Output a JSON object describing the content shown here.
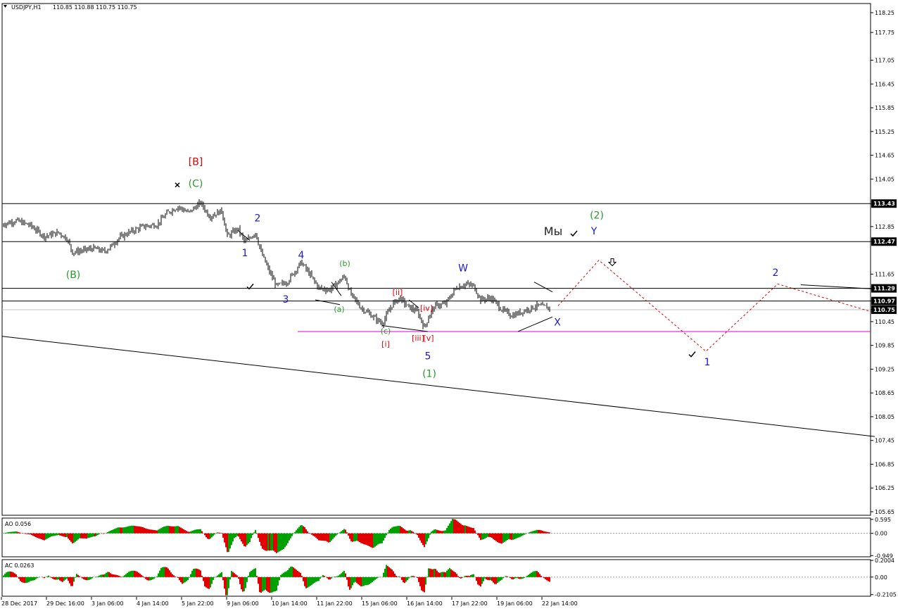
{
  "chart_data": {
    "type": "candlestick",
    "header": {
      "symbol": "USDJPY,H1",
      "quote": "110.85 110.88 110.75 110.75"
    },
    "price_axis": {
      "range": [
        105.65,
        118.25
      ],
      "ticks": [
        "118.25",
        "117.75",
        "117.05",
        "116.45",
        "115.85",
        "115.25",
        "114.65",
        "114.05",
        "113.43",
        "112.85",
        "112.47",
        "111.65",
        "111.29",
        "110.97",
        "110.75",
        "110.45",
        "109.85",
        "109.25",
        "108.65",
        "108.05",
        "107.45",
        "106.85",
        "106.25",
        "105.65"
      ]
    },
    "time_axis": {
      "labels": [
        "28 Dec 2017",
        "29 Dec 16:00",
        "3 Jan 06:00",
        "4 Jan 14:00",
        "5 Jan 22:00",
        "9 Jan 06:00",
        "10 Jan 14:00",
        "11 Jan 22:00",
        "15 Jan 06:00",
        "16 Jan 14:00",
        "17 Jan 22:00",
        "19 Jan 06:00",
        "22 Jan 14:00"
      ]
    },
    "price_tags": [
      {
        "value": "113.43",
        "price": 113.43
      },
      {
        "value": "112.47",
        "price": 112.47
      },
      {
        "value": "111.29",
        "price": 111.29
      },
      {
        "value": "110.97",
        "price": 110.97
      },
      {
        "value": "110.75",
        "price": 110.75
      }
    ],
    "horizontal_levels": [
      113.43,
      112.47,
      111.29,
      110.97
    ],
    "support_level": 110.2,
    "trendline": {
      "from": [
        0,
        110.08
      ],
      "to": [
        1240,
        107.55
      ]
    },
    "price_path": [
      [
        0,
        112.9
      ],
      [
        20,
        113.0
      ],
      [
        40,
        112.88
      ],
      [
        60,
        112.6
      ],
      [
        80,
        112.7
      ],
      [
        92,
        112.55
      ],
      [
        100,
        112.2
      ],
      [
        115,
        112.25
      ],
      [
        130,
        112.3
      ],
      [
        145,
        112.22
      ],
      [
        155,
        112.35
      ],
      [
        165,
        112.55
      ],
      [
        180,
        112.7
      ],
      [
        200,
        112.85
      ],
      [
        220,
        112.9
      ],
      [
        235,
        113.2
      ],
      [
        250,
        113.35
      ],
      [
        265,
        113.2
      ],
      [
        282,
        113.45
      ],
      [
        295,
        113.1
      ],
      [
        312,
        113.25
      ],
      [
        320,
        112.6
      ],
      [
        335,
        112.8
      ],
      [
        345,
        112.45
      ],
      [
        360,
        112.7
      ],
      [
        368,
        112.2
      ],
      [
        380,
        111.7
      ],
      [
        390,
        111.35
      ],
      [
        405,
        111.45
      ],
      [
        415,
        111.7
      ],
      [
        425,
        111.95
      ],
      [
        435,
        111.7
      ],
      [
        450,
        111.3
      ],
      [
        465,
        111.25
      ],
      [
        478,
        111.45
      ],
      [
        487,
        111.6
      ],
      [
        495,
        111.15
      ],
      [
        510,
        110.8
      ],
      [
        525,
        110.6
      ],
      [
        540,
        110.4
      ],
      [
        555,
        110.9
      ],
      [
        565,
        111.05
      ],
      [
        575,
        110.85
      ],
      [
        590,
        110.7
      ],
      [
        600,
        110.3
      ],
      [
        607,
        110.6
      ],
      [
        615,
        110.85
      ],
      [
        630,
        110.9
      ],
      [
        645,
        111.3
      ],
      [
        658,
        111.4
      ],
      [
        670,
        111.35
      ],
      [
        680,
        111.0
      ],
      [
        695,
        111.05
      ],
      [
        710,
        110.75
      ],
      [
        725,
        110.6
      ],
      [
        745,
        110.75
      ],
      [
        760,
        110.85
      ],
      [
        778,
        110.8
      ]
    ],
    "forecast_path": [
      [
        790,
        110.85
      ],
      [
        848,
        112.0
      ],
      [
        1000,
        109.7
      ],
      [
        1102,
        111.4
      ],
      [
        1235,
        110.7
      ]
    ],
    "forecast_resistance": [
      [
        1135,
        111.38
      ],
      [
        1235,
        111.28
      ]
    ],
    "wedge_lines": [
      {
        "from": [
          733,
          110.2
        ],
        "to": [
          782,
          110.57
        ]
      },
      {
        "from": [
          756,
          111.45
        ],
        "to": [
          782,
          111.2
        ]
      },
      {
        "from": [
          335,
          112.75
        ],
        "to": [
          352,
          112.5
        ]
      },
      {
        "from": [
          468,
          111.45
        ],
        "to": [
          482,
          111.1
        ]
      },
      {
        "from": [
          445,
          111.0
        ],
        "to": [
          480,
          110.88
        ]
      },
      {
        "from": [
          540,
          110.35
        ],
        "to": [
          605,
          110.2
        ]
      },
      {
        "from": [
          578,
          111.0
        ],
        "to": [
          592,
          110.8
        ]
      }
    ],
    "wave_labels": [
      {
        "text": "[B]",
        "t": 275,
        "p": 114.4,
        "color": "#e00000",
        "size": 14
      },
      {
        "text": "(C)",
        "t": 275,
        "p": 113.85,
        "color": "#2a9a2a",
        "size": 14
      },
      {
        "text": "(B)",
        "t": 101,
        "p": 111.55,
        "color": "#2a9a2a",
        "size": 14
      },
      {
        "text": "2",
        "t": 363,
        "p": 112.98,
        "color": "#1a1acc",
        "size": 14
      },
      {
        "text": "1",
        "t": 345,
        "p": 112.1,
        "color": "#1a1acc",
        "size": 14
      },
      {
        "text": "4",
        "t": 425,
        "p": 112.05,
        "color": "#1a1acc",
        "size": 14
      },
      {
        "text": "3",
        "t": 403,
        "p": 110.93,
        "color": "#1a1acc",
        "size": 14
      },
      {
        "text": "(b)",
        "t": 487,
        "p": 111.85,
        "color": "#2a9a2a",
        "size": 11
      },
      {
        "text": "(a)",
        "t": 479,
        "p": 110.7,
        "color": "#2a9a2a",
        "size": 11
      },
      {
        "text": "(c)",
        "t": 545,
        "p": 110.15,
        "color": "#2a9a2a",
        "size": 11
      },
      {
        "text": "[ii]",
        "t": 562,
        "p": 111.12,
        "color": "#e00000",
        "size": 11
      },
      {
        "text": "[i]",
        "t": 545,
        "p": 109.82,
        "color": "#e00000",
        "size": 11
      },
      {
        "text": "[iv]",
        "t": 603,
        "p": 110.72,
        "color": "#e00000",
        "size": 11
      },
      {
        "text": "[iii]",
        "t": 591,
        "p": 109.97,
        "color": "#e00000",
        "size": 11
      },
      {
        "text": "[v]",
        "t": 606,
        "p": 109.97,
        "color": "#e00000",
        "size": 11
      },
      {
        "text": "5",
        "t": 605,
        "p": 109.5,
        "color": "#1a1acc",
        "size": 14
      },
      {
        "text": "(1)",
        "t": 607,
        "p": 109.05,
        "color": "#2a9a2a",
        "size": 14
      },
      {
        "text": "W",
        "t": 655,
        "p": 111.72,
        "color": "#1a1acc",
        "size": 14
      },
      {
        "text": "X",
        "t": 789,
        "p": 110.35,
        "color": "#1a1acc",
        "size": 14
      },
      {
        "text": "(2)",
        "t": 845,
        "p": 113.05,
        "color": "#2a9a2a",
        "size": 14
      },
      {
        "text": "Y",
        "t": 841,
        "p": 112.65,
        "color": "#1a1acc",
        "size": 14
      },
      {
        "text": "Мы",
        "t": 783,
        "p": 112.63,
        "color": "#222222",
        "size": 16
      },
      {
        "text": "2",
        "t": 1099,
        "p": 111.6,
        "color": "#1a1acc",
        "size": 14
      },
      {
        "text": "1",
        "t": 1002,
        "p": 109.35,
        "color": "#1a1acc",
        "size": 14
      }
    ],
    "checkmarks": [
      [
        352,
        111.33
      ],
      [
        812,
        112.67
      ],
      [
        980,
        109.62
      ]
    ],
    "crosses": [
      [
        249,
        113.9
      ]
    ],
    "arrows": [
      [
        867,
        111.95
      ]
    ],
    "oscillators": [
      {
        "name": "AO",
        "value": "0.056",
        "ticks": [
          "0.595",
          "0.00",
          "-0.949"
        ],
        "range": [
          -1.0,
          0.65
        ]
      },
      {
        "name": "AC",
        "value": "0.0263",
        "ticks": [
          "0.2004",
          "0.00",
          "-0.2105"
        ],
        "range": [
          -0.23,
          0.21
        ]
      }
    ],
    "colors": {
      "up": "#00a000",
      "down": "#e00000",
      "magenta": "#e000e0",
      "forecast": "#e00000"
    }
  }
}
